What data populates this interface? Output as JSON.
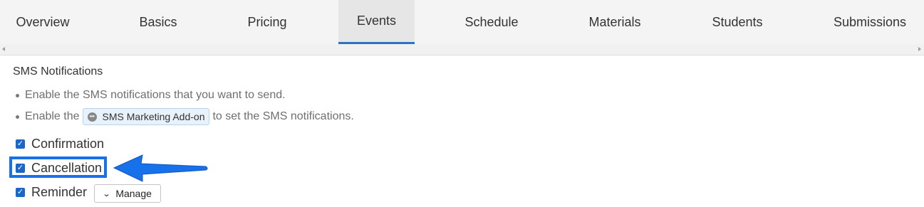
{
  "tabs": [
    {
      "label": "Overview",
      "active": false
    },
    {
      "label": "Basics",
      "active": false
    },
    {
      "label": "Pricing",
      "active": false
    },
    {
      "label": "Events",
      "active": true
    },
    {
      "label": "Schedule",
      "active": false
    },
    {
      "label": "Materials",
      "active": false
    },
    {
      "label": "Students",
      "active": false
    },
    {
      "label": "Submissions",
      "active": false
    }
  ],
  "sms": {
    "title": "SMS Notifications",
    "note1": "Enable the SMS notifications that you want to send.",
    "note2_prefix": "Enable the",
    "addon_label": "SMS Marketing Add-on",
    "note2_suffix": "to set the SMS notifications.",
    "options": [
      {
        "label": "Confirmation",
        "checked": true
      },
      {
        "label": "Cancellation",
        "checked": true,
        "highlighted": true
      },
      {
        "label": "Reminder",
        "checked": true
      }
    ],
    "manage_label": "Manage"
  },
  "colors": {
    "accent": "#2a73c5",
    "checkbox": "#1a66c9",
    "highlight": "#1671ea"
  }
}
